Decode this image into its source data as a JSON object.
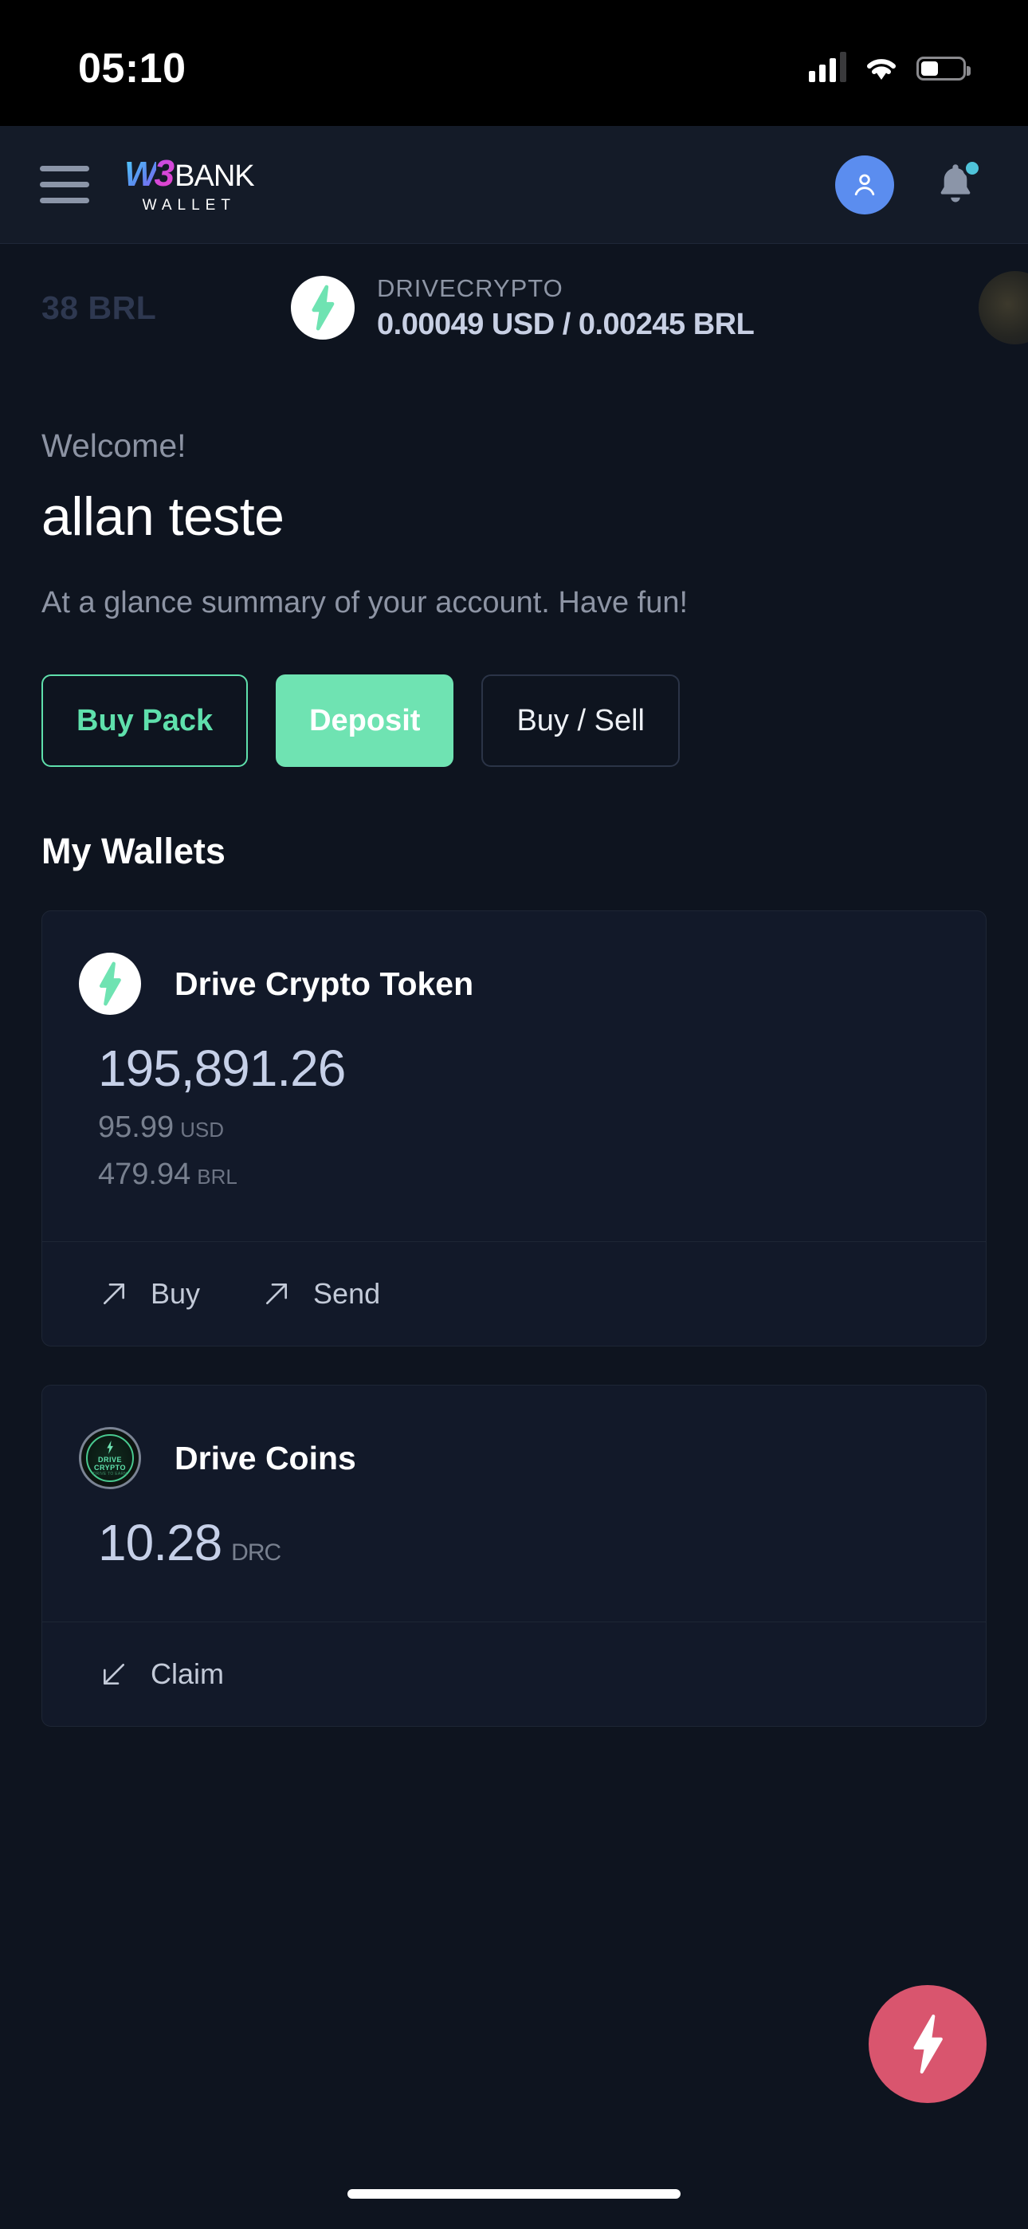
{
  "status_bar": {
    "time": "05:10",
    "signal_icon": "cellular-signal-icon",
    "wifi_icon": "wifi-icon",
    "battery_icon": "battery-icon"
  },
  "header": {
    "menu_icon": "hamburger-menu-icon",
    "logo": {
      "w": "W",
      "three": "3",
      "bank": "BANK",
      "sub": "WALLET"
    },
    "avatar_icon": "user-avatar-icon",
    "bell_icon": "notification-bell-icon",
    "has_notification": true
  },
  "ticker": {
    "prev_item_partial": "38 BRL",
    "symbol": "DRIVECRYPTO",
    "price": "0.00049 USD / 0.00245 BRL",
    "icon": "lightning-bolt-icon"
  },
  "greeting": {
    "welcome": "Welcome!",
    "username": "allan teste",
    "tagline": "At a glance summary of your account. Have fun!"
  },
  "actions": [
    {
      "label": "Buy Pack",
      "style": "outline-green"
    },
    {
      "label": "Deposit",
      "style": "filled-green"
    },
    {
      "label": "Buy / Sell",
      "style": "outline-gray"
    }
  ],
  "wallets_section": {
    "title": "My Wallets",
    "cards": [
      {
        "name": "Drive Crypto Token",
        "icon": "lightning-bolt-icon",
        "balance": "195,891.26",
        "sub_values": [
          {
            "value": "95.99",
            "unit": "USD"
          },
          {
            "value": "479.94",
            "unit": "BRL"
          }
        ],
        "footer_actions": [
          {
            "label": "Buy",
            "icon": "arrow-up-right-icon"
          },
          {
            "label": "Send",
            "icon": "arrow-up-right-icon"
          }
        ]
      },
      {
        "name": "Drive Coins",
        "icon": "drive-crypto-badge-icon",
        "badge_line1": "DRIVE",
        "badge_line2": "CRYPTO",
        "badge_line3": "DRIVE TO EARN",
        "balance": "10.28",
        "balance_unit": "DRC",
        "footer_actions": [
          {
            "label": "Claim",
            "icon": "arrow-down-left-icon"
          }
        ]
      }
    ]
  },
  "fab": {
    "icon": "lightning-bolt-icon",
    "color": "#d9556e"
  },
  "colors": {
    "background": "#0e141f",
    "header": "#141b28",
    "card": "#121929",
    "accent_green": "#6fe3b2",
    "accent_blue": "#5b8def",
    "accent_pink": "#d9556e",
    "text_muted": "#8d94a4"
  }
}
